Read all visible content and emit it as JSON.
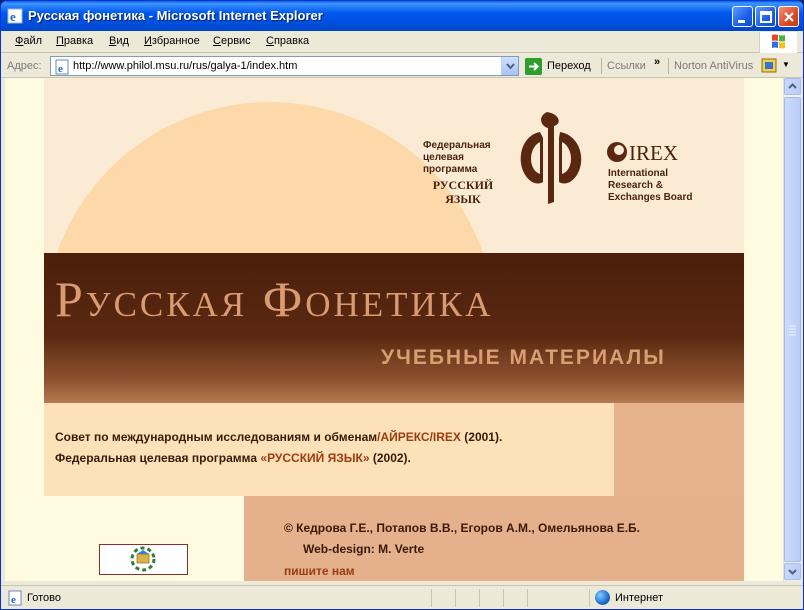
{
  "window": {
    "title": "Русская фонетика - Microsoft Internet Explorer"
  },
  "menu": [
    {
      "pre": "",
      "u": "Ф",
      "post": "айл"
    },
    {
      "pre": "",
      "u": "П",
      "post": "равка"
    },
    {
      "pre": "",
      "u": "В",
      "post": "ид"
    },
    {
      "pre": "",
      "u": "И",
      "post": "збранное"
    },
    {
      "pre": "",
      "u": "С",
      "post": "ервис"
    },
    {
      "pre": "",
      "u": "С",
      "post": "правка"
    }
  ],
  "address": {
    "label": "Адрес:",
    "url": "http://www.philol.msu.ru/rus/galya-1/index.htm",
    "go_label": "Переход",
    "links_label": "Ссылки",
    "links_chevron": "»",
    "norton_label": "Norton AntiVirus"
  },
  "page": {
    "title_main": "Русская Фонетика",
    "title_sub": "УЧЕБНЫЕ МАТЕРИАЛЫ",
    "fcp_lines": [
      "Федеральная",
      "целевая",
      "программа"
    ],
    "fcp_ru_lines": [
      "РУССКИЙ",
      "ЯЗЫК"
    ],
    "irex_name": "IREX",
    "irex_lines": [
      "International",
      "Research &",
      "Exchanges Board"
    ],
    "info_line1": {
      "text": "Совет по международным исследованиям и обменам",
      "highlight": "/АЙРЕКС/IREX",
      "suffix": " (2001)."
    },
    "info_line2": {
      "text": "Федеральная целевая программа ",
      "highlight": "«РУССКИЙ ЯЗЫК»",
      "suffix": " (2002)."
    },
    "credits_authors": "©  Кедрова Г.Е.,  Потапов В.В.,  Егоров А.М.,  Омельянова Е.Б.",
    "credits_design": "Web-design:  M. Verte",
    "mail_link": "пишите нам"
  },
  "status": {
    "text": "Готово",
    "zone": "Интернет"
  },
  "colors": {
    "titlebar": "#0058ee",
    "banner": "#5a2810",
    "accent_text": "#9b3c0f",
    "peach": "#fdd9a9"
  }
}
